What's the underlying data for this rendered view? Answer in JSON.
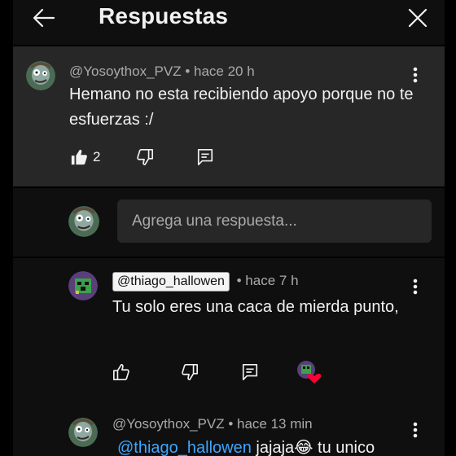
{
  "header": {
    "title": "Respuestas",
    "back_icon": "arrow-left-icon",
    "close_icon": "close-icon"
  },
  "parent_comment": {
    "author": "@Yosoythox_PVZ",
    "time": "• hace 20 h",
    "text": "Hemano no esta recibiendo apoyo porque no te esfuerzas :/",
    "likes": "2"
  },
  "reply_box": {
    "placeholder": "Agrega una respuesta..."
  },
  "replies": [
    {
      "author": "@thiago_hallowen",
      "time": "• hace 7 h",
      "text": "Tu solo eres una caca de mierda punto,"
    },
    {
      "author": "@Yosoythox_PVZ",
      "time": "• hace 13 min",
      "mention": "@thiago_hallowen",
      "text": " jajaja😂 tu unico"
    }
  ],
  "colors": {
    "background": "#0f0f0f",
    "highlight": "#272727",
    "text": "#f1f1f1",
    "muted": "#aaaaaa",
    "mention": "#3ea6ff",
    "heart": "#ff0033"
  }
}
